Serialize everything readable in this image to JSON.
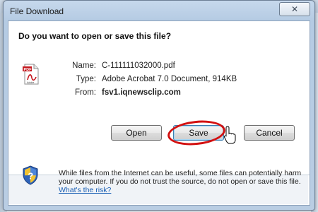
{
  "window": {
    "title": "File Download",
    "close_glyph": "✕"
  },
  "dialog": {
    "question": "Do you want to open or save this file?",
    "fields": {
      "name_label": "Name:",
      "name_value": "C-111111032000.pdf",
      "type_label": "Type:",
      "type_value": "Adobe Acrobat 7.0 Document, 914KB",
      "from_label": "From:",
      "from_value": "fsv1.iqnewsclip.com"
    },
    "buttons": {
      "open": "Open",
      "save": "Save",
      "cancel": "Cancel"
    },
    "warning": {
      "text": "While files from the Internet can be useful, some files can potentially harm your computer. If you do not trust the source, do not open or save this file.",
      "link": "What's the risk?"
    },
    "icons": {
      "file": "pdf-file-icon",
      "warning": "security-shield-icon",
      "cursor": "mouse-pointer-icon"
    },
    "colors": {
      "highlight_circle": "#d21010",
      "link": "#1a5fb4"
    }
  }
}
